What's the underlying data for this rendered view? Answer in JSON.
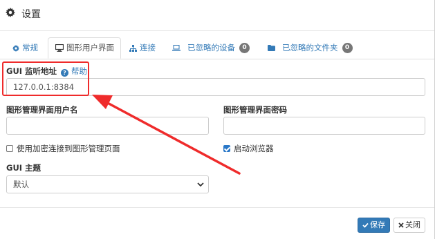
{
  "dialog": {
    "title": "设置"
  },
  "tabs": [
    {
      "label": "常规",
      "icon": "gear-icon",
      "active": false
    },
    {
      "label": "图形用户界面",
      "icon": "desktop-icon",
      "active": true
    },
    {
      "label": "连接",
      "icon": "sitemap-icon",
      "active": false
    },
    {
      "label": "已忽略的设备",
      "icon": "laptop-icon",
      "active": false,
      "badge": "0"
    },
    {
      "label": "已忽略的文件夹",
      "icon": "folder-icon",
      "active": false,
      "badge": "0"
    }
  ],
  "gui": {
    "listen_address_label": "GUI 监听地址",
    "help_label": "帮助",
    "listen_address_value": "127.0.0.1:8384",
    "username_label": "图形管理界面用户名",
    "username_value": "",
    "password_label": "图形管理界面密码",
    "password_value": "",
    "https_label": "使用加密连接到图形管理页面",
    "https_checked": false,
    "browser_label": "启动浏览器",
    "browser_checked": true,
    "theme_label": "GUI 主题",
    "theme_value": "默认"
  },
  "footer": {
    "save_label": "保存",
    "close_label": "关闭"
  },
  "colors": {
    "accent": "#337ab7",
    "annotation": "#ef2b2b",
    "badge": "#777777"
  }
}
